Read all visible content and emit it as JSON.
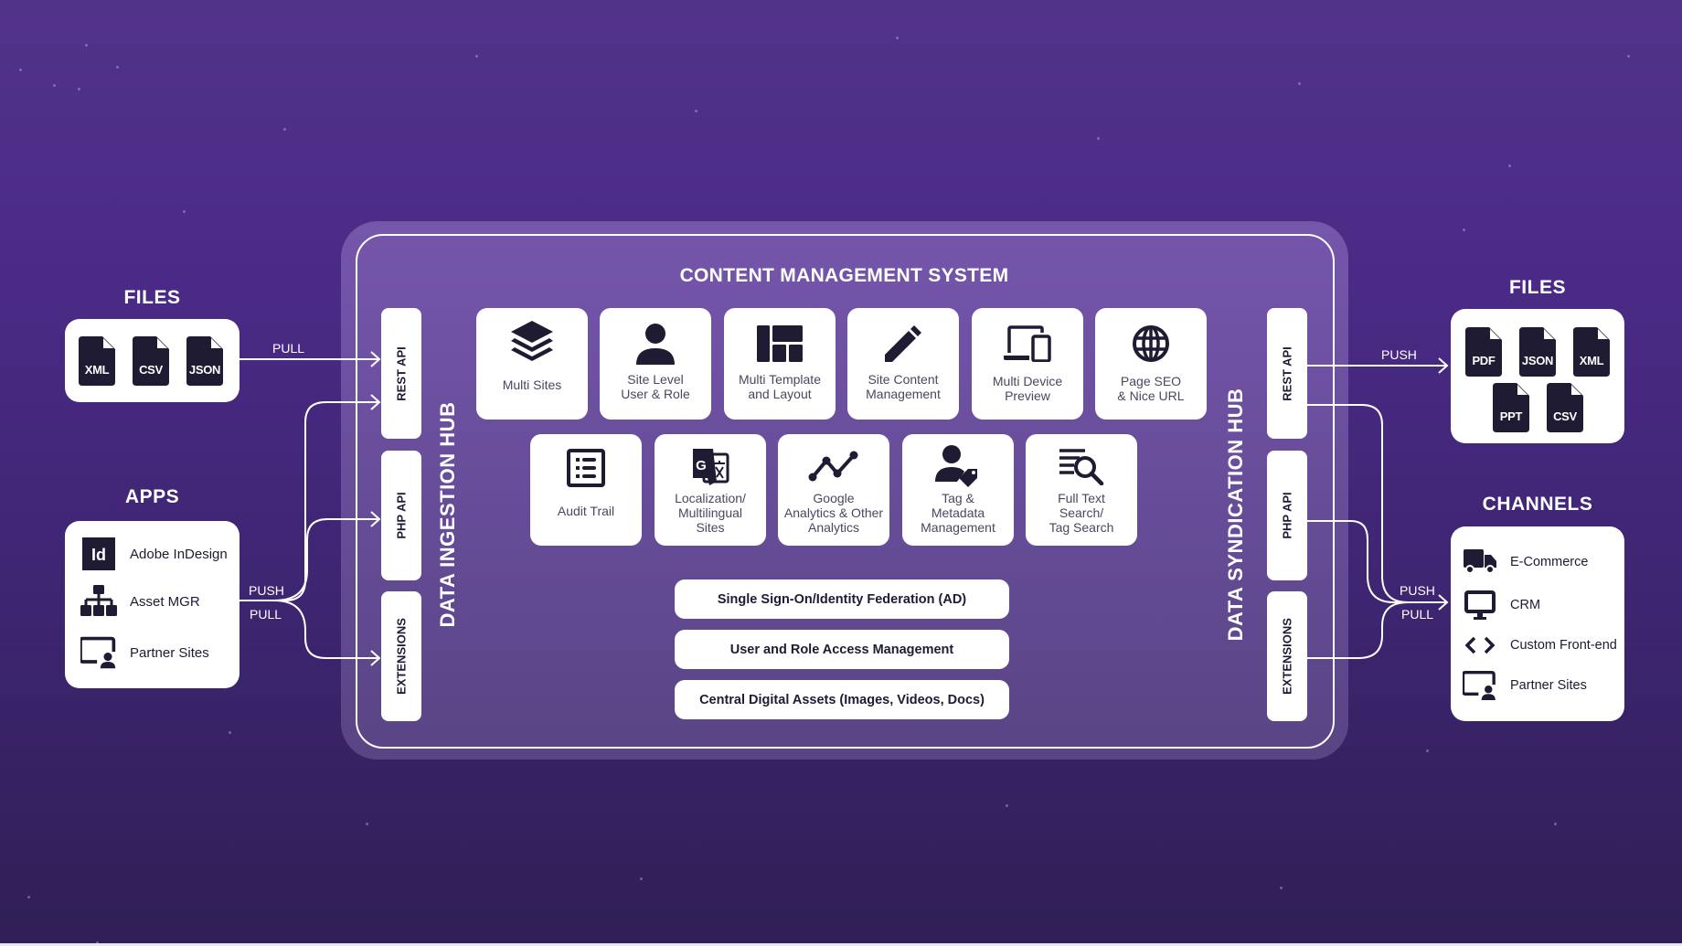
{
  "left": {
    "files": {
      "title": "FILES",
      "items": [
        "XML",
        "CSV",
        "JSON"
      ],
      "connector_label": "PULL"
    },
    "apps": {
      "title": "APPS",
      "items": [
        {
          "label": "Adobe InDesign",
          "icon": "indesign-icon"
        },
        {
          "label": "Asset MGR",
          "icon": "hierarchy-icon"
        },
        {
          "label": "Partner Sites",
          "icon": "partner-sites-icon"
        }
      ],
      "connector_labels": [
        "PUSH",
        "PULL"
      ]
    }
  },
  "cms": {
    "title": "CONTENT MANAGEMENT SYSTEM",
    "ingestion_hub": {
      "label": "DATA INGESTION HUB",
      "endpoints": [
        "REST API",
        "PHP API",
        "EXTENSIONS"
      ]
    },
    "syndication_hub": {
      "label": "DATA SYNDICATION HUB",
      "endpoints": [
        "REST API",
        "PHP API",
        "EXTENSIONS"
      ]
    },
    "features_row1": [
      {
        "label": "Multi Sites",
        "icon": "layers-icon"
      },
      {
        "label": "Site Level\nUser & Role",
        "icon": "user-icon"
      },
      {
        "label": "Multi Template\nand Layout",
        "icon": "layout-icon"
      },
      {
        "label": "Site Content\nManagement",
        "icon": "pencil-icon"
      },
      {
        "label": "Multi Device\nPreview",
        "icon": "devices-icon"
      },
      {
        "label": "Page SEO\n& Nice URL",
        "icon": "globe-icon"
      }
    ],
    "features_row2": [
      {
        "label": "Audit Trail",
        "icon": "list-icon"
      },
      {
        "label": "Localization/\nMultilingual\nSites",
        "icon": "translate-icon"
      },
      {
        "label": "Google\nAnalytics & Other\nAnalytics",
        "icon": "analytics-icon"
      },
      {
        "label": "Tag &\nMetadata\nManagement",
        "icon": "user-tag-icon"
      },
      {
        "label": "Full Text\nSearch/\nTag Search",
        "icon": "text-search-icon"
      }
    ],
    "services": [
      "Single Sign-On/Identity Federation (AD)",
      "User and Role Access Management",
      "Central Digital Assets (Images, Videos, Docs)"
    ]
  },
  "right": {
    "files": {
      "title": "FILES",
      "items": [
        "PDF",
        "JSON",
        "XML",
        "PPT",
        "CSV"
      ],
      "connector_label": "PUSH"
    },
    "channels": {
      "title": "CHANNELS",
      "items": [
        {
          "label": "E-Commerce",
          "icon": "truck-icon"
        },
        {
          "label": "CRM",
          "icon": "monitor-icon"
        },
        {
          "label": "Custom Front-end",
          "icon": "code-icon"
        },
        {
          "label": "Partner Sites",
          "icon": "partner-sites-icon"
        }
      ],
      "connector_labels": [
        "PUSH",
        "PULL"
      ]
    }
  },
  "colors": {
    "background_top": "#52338a",
    "background_bottom": "#2f1f55",
    "icon_dark": "#1e1b33",
    "text_gray": "#4a4760",
    "white": "#ffffff"
  }
}
